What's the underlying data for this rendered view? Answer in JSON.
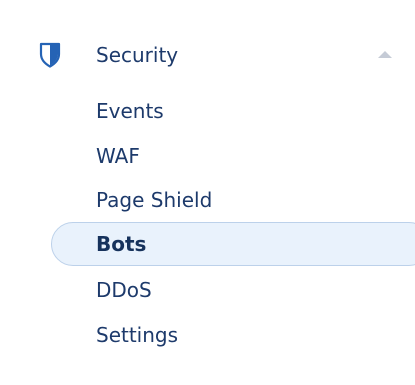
{
  "sidebar": {
    "section": {
      "label": "Security",
      "icon": "shield-icon",
      "expanded": true,
      "collapse_icon": "chevron-up-icon"
    },
    "items": [
      {
        "label": "Events",
        "active": false
      },
      {
        "label": "WAF",
        "active": false
      },
      {
        "label": "Page Shield",
        "active": false
      },
      {
        "label": "Bots",
        "active": true
      },
      {
        "label": "DDoS",
        "active": false
      },
      {
        "label": "Settings",
        "active": false
      }
    ]
  },
  "colors": {
    "text": "#1d3a6b",
    "active_text": "#16325c",
    "active_bg": "#e9f2fc",
    "active_border": "#bcd1ea",
    "chevron": "#c5cbd6"
  }
}
